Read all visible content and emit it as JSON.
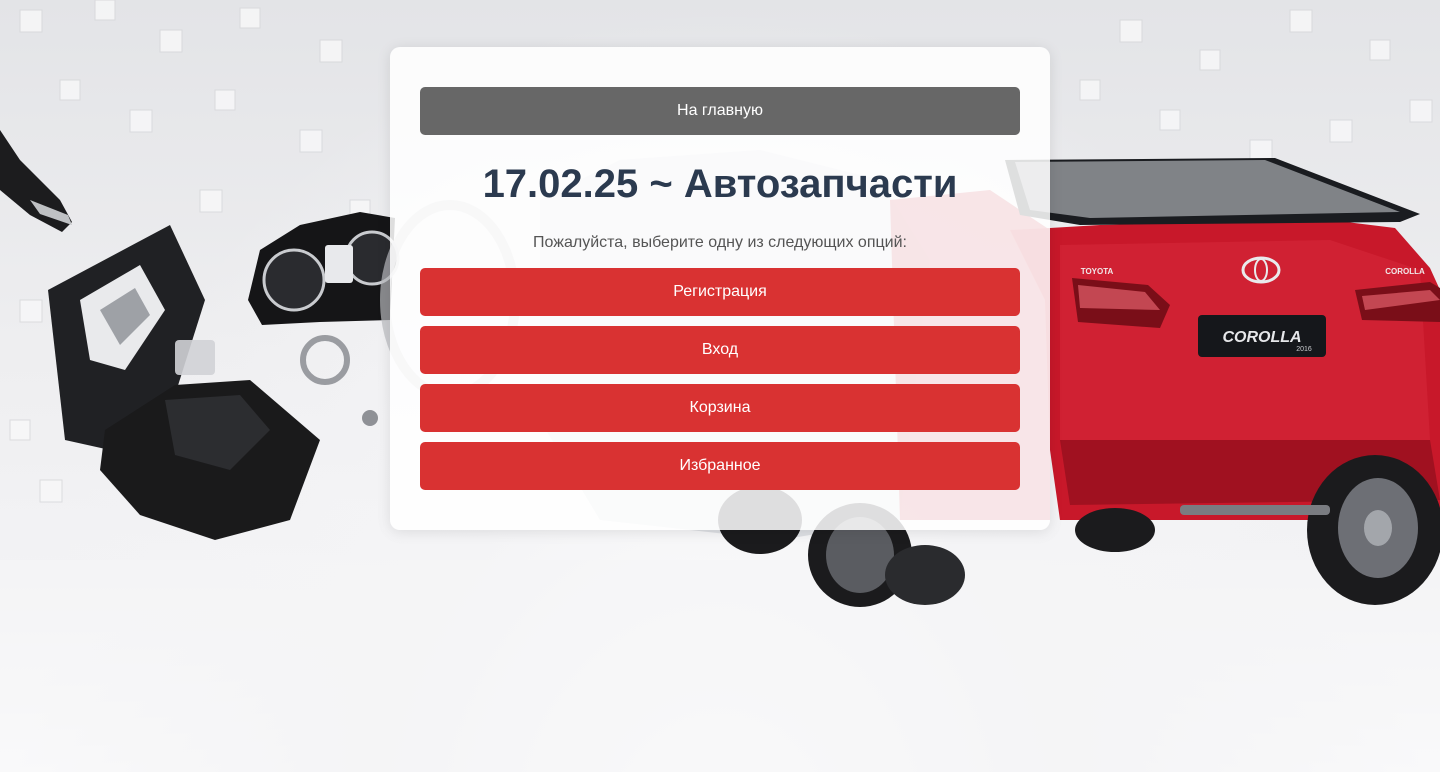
{
  "nav": {
    "home_label": "На главную"
  },
  "header": {
    "title": "17.02.25 ~ Автозапчасти",
    "subtitle": "Пожалуйста, выберите одну из следующих опций:"
  },
  "menu": {
    "items": [
      {
        "label": "Регистрация"
      },
      {
        "label": "Вход"
      },
      {
        "label": "Корзина"
      },
      {
        "label": "Избранное"
      }
    ]
  },
  "background": {
    "car_badge": "COROLLA",
    "car_model_year": "2016",
    "car_brand": "TOYOTA"
  },
  "colors": {
    "home_button": "#676767",
    "action_button": "#d93232",
    "title_text": "#2b3a4f",
    "car_body": "#c8182a"
  }
}
